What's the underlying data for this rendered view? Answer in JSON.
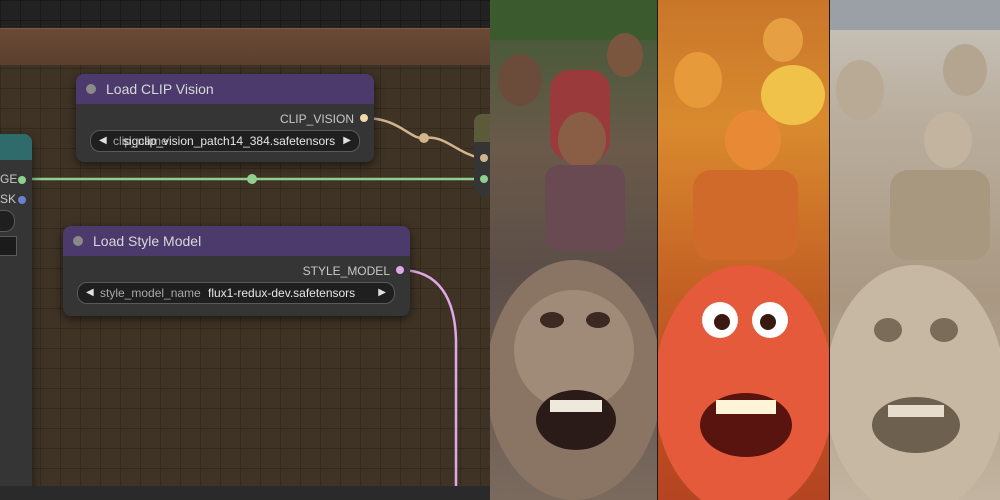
{
  "canvas": {
    "colors": {
      "background": "#222222",
      "group_body": "#3f3325",
      "group_header": "#5b3f2e",
      "node_body": "#353535",
      "node_title_purple": "#4b3a6b",
      "wire_green": "#8fd08f",
      "wire_tan": "#d2b48c",
      "wire_pink": "#e0a8e8"
    },
    "partial_left_node": {
      "output_fragment_1": "GE",
      "output_fragment_2": "SK"
    },
    "nodes": [
      {
        "title": "Load CLIP Vision",
        "output": "CLIP_VISION",
        "output_color": "#f2d8a6",
        "widget_name": "clip_name",
        "widget_value": "sigclip_vision_patch14_384.safetensors"
      },
      {
        "title": "Load Style Model",
        "output": "STYLE_MODEL",
        "output_color": "#e0a8e8",
        "widget_name": "style_model_name",
        "widget_value": "flux1-redux-dev.safetensors"
      }
    ]
  },
  "image_strip": {
    "panels": [
      {
        "name": "photo-hikers-monkey"
      },
      {
        "name": "cartoon-hikers-monkey"
      },
      {
        "name": "stone-sculpture-hikers-monkey"
      }
    ]
  }
}
